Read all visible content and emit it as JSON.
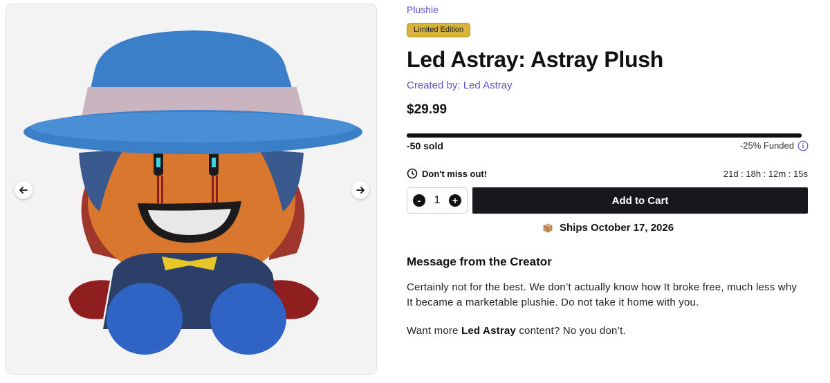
{
  "gallery": {
    "image_alt": "Led Astray plush",
    "prev_icon": "arrow-left-icon",
    "next_icon": "arrow-right-icon"
  },
  "product": {
    "category": "Plushie",
    "badge": "Limited Edition",
    "title": "Led Astray: Astray Plush",
    "creator": "Created by: Led Astray",
    "price": "$29.99"
  },
  "funding": {
    "progress_fraction": 1.0,
    "sold_text": "-50 sold",
    "funded_text": "-25% Funded",
    "info_icon": "info-icon"
  },
  "urgency": {
    "label": "Don't miss out!",
    "countdown": "21d : 18h : 12m : 15s",
    "icon": "clock-icon"
  },
  "cart": {
    "decrement": "-",
    "quantity": "1",
    "increment": "+",
    "add_label": "Add to Cart"
  },
  "shipping": {
    "icon": "box-icon",
    "text": "Ships October 17, 2026"
  },
  "message": {
    "heading": "Message from the Creator",
    "body": "Certainly not for the best. We don’t actually know how It broke free, much less why It became a marketable plushie. Do not take it home with you.",
    "more_prefix": "Want more ",
    "more_bold": "Led Astray",
    "more_suffix": " content? No you don’t."
  },
  "colors": {
    "accent": "#5a54c9",
    "badge": "#d9b23a",
    "button": "#17171c"
  }
}
